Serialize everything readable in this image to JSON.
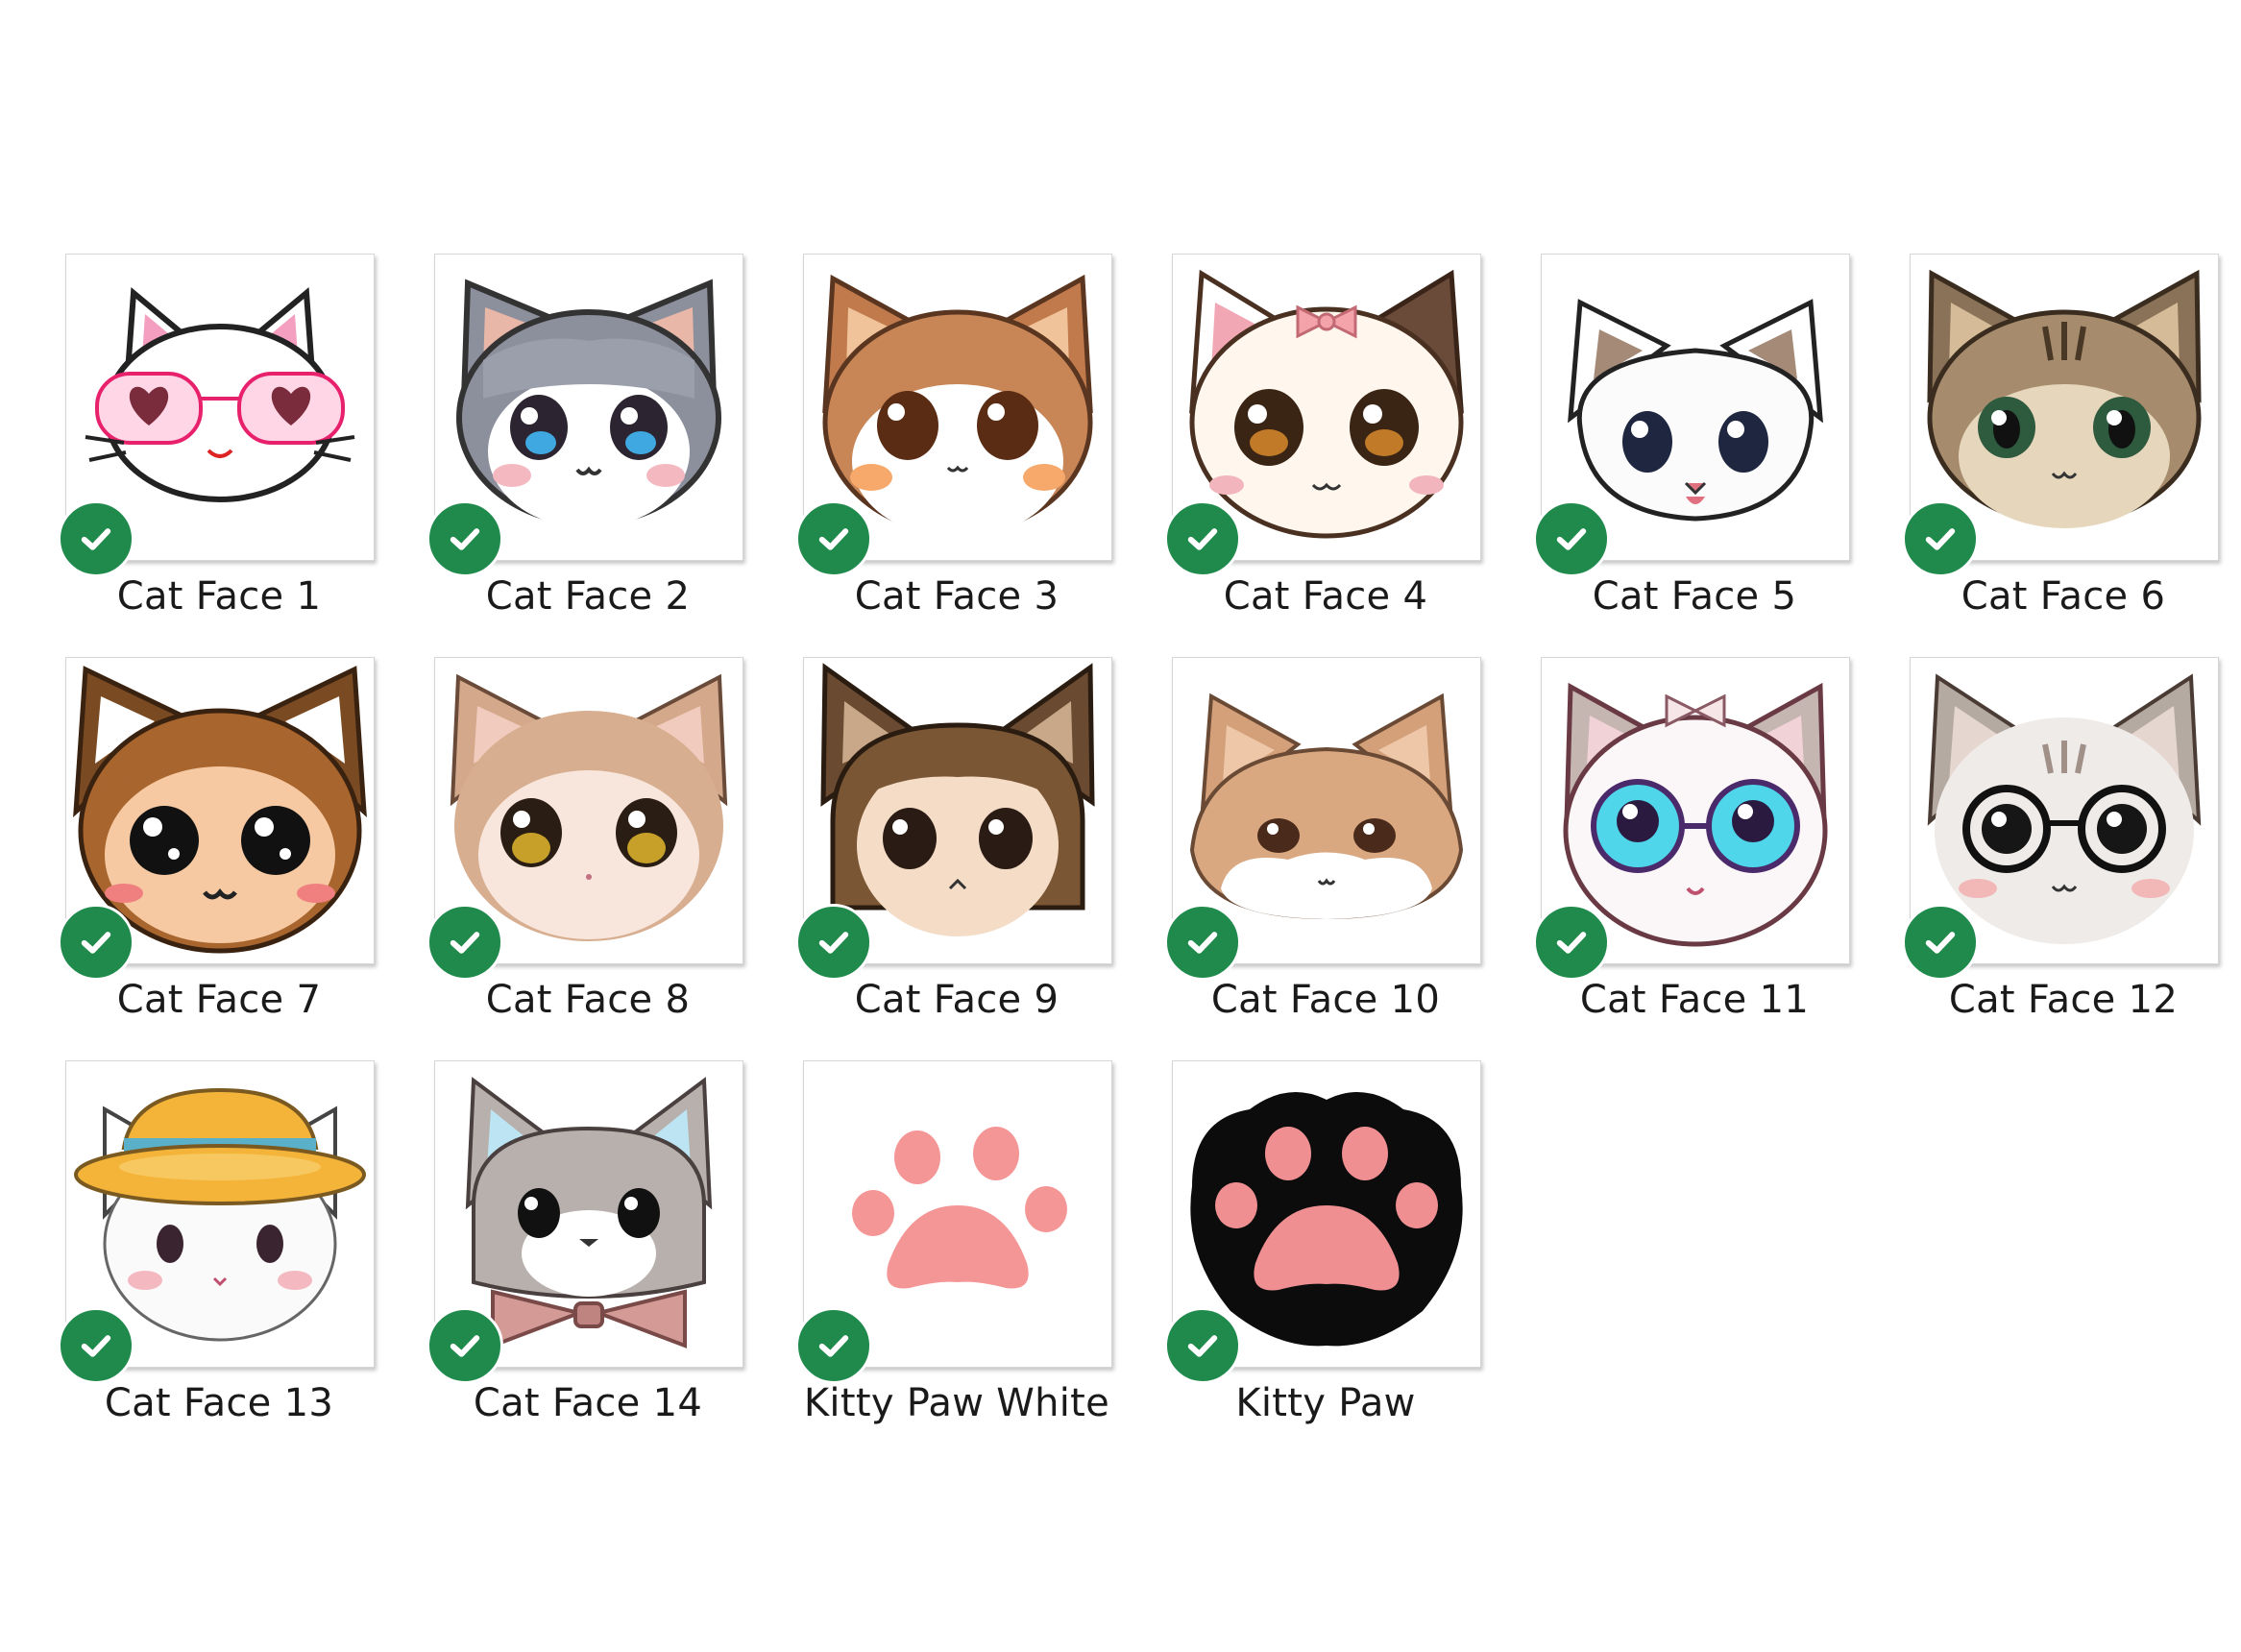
{
  "files": [
    {
      "name": "Cat Face 1",
      "icon": "cat-face-pink-heart-glasses-icon",
      "status": "synced-check-icon"
    },
    {
      "name": "Cat Face 2",
      "icon": "cat-face-gray-fluffy-icon",
      "status": "synced-check-icon"
    },
    {
      "name": "Cat Face 3",
      "icon": "cat-face-brown-blush-icon",
      "status": "synced-check-icon"
    },
    {
      "name": "Cat Face 4",
      "icon": "cat-face-white-bow-icon",
      "status": "synced-check-icon"
    },
    {
      "name": "Cat Face 5",
      "icon": "cat-face-white-icon",
      "status": "synced-check-icon"
    },
    {
      "name": "Cat Face 6",
      "icon": "cat-face-tabby-icon",
      "status": "synced-check-icon"
    },
    {
      "name": "Cat Face 7",
      "icon": "cat-face-girl-brown-hair-icon",
      "status": "synced-check-icon"
    },
    {
      "name": "Cat Face 8",
      "icon": "cat-face-beige-hair-icon",
      "status": "synced-check-icon"
    },
    {
      "name": "Cat Face 9",
      "icon": "cat-face-brown-bob-icon",
      "status": "synced-check-icon"
    },
    {
      "name": "Cat Face 10",
      "icon": "cat-face-tan-fluffy-icon",
      "status": "synced-check-icon"
    },
    {
      "name": "Cat Face 11",
      "icon": "cat-face-round-glasses-icon",
      "status": "synced-check-icon"
    },
    {
      "name": "Cat Face 12",
      "icon": "cat-face-black-glasses-icon",
      "status": "synced-check-icon"
    },
    {
      "name": "Cat Face 13",
      "icon": "cat-face-yellow-hat-icon",
      "status": "synced-check-icon"
    },
    {
      "name": "Cat Face 14",
      "icon": "cat-face-bowtie-icon",
      "status": "synced-check-icon"
    },
    {
      "name": "Kitty Paw White",
      "icon": "pink-paw-print-icon",
      "status": "synced-check-icon"
    },
    {
      "name": "Kitty Paw",
      "icon": "black-paw-pink-pads-icon",
      "status": "synced-check-icon"
    }
  ],
  "colors": {
    "sync_check": "#1f8a4c",
    "label_text": "#1a1a1a",
    "thumbnail_border": "#d6d6d6"
  }
}
